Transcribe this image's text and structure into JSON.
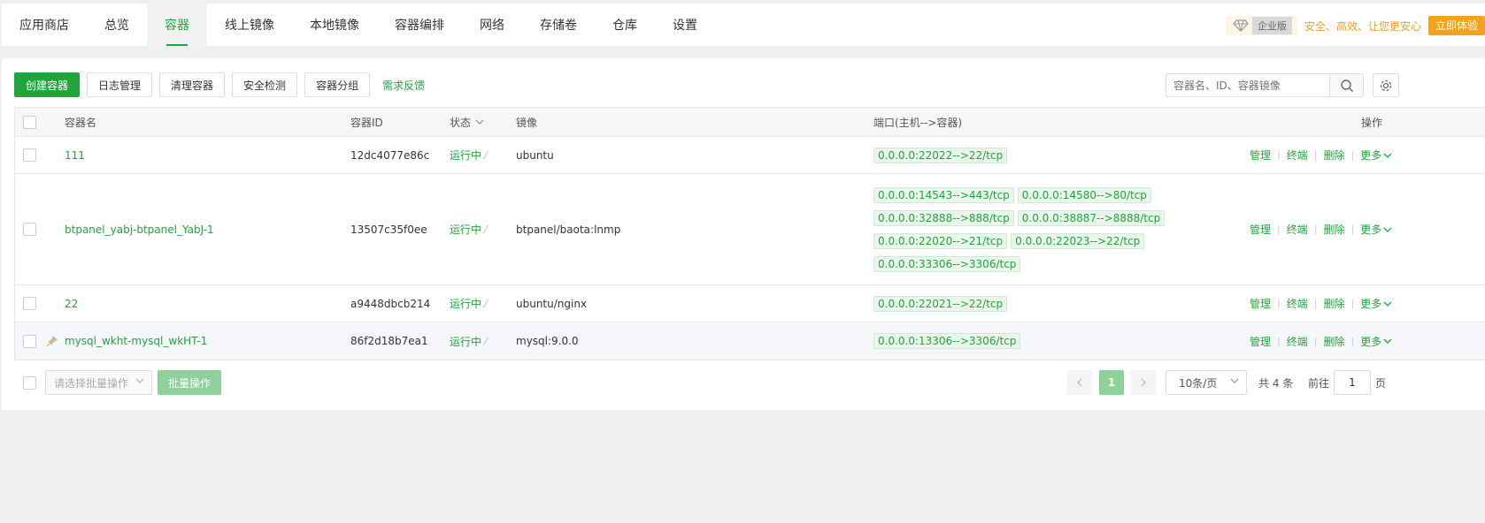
{
  "nav": {
    "items": [
      "应用商店",
      "总览",
      "容器",
      "线上镜像",
      "本地镜像",
      "容器编排",
      "网络",
      "存储卷",
      "仓库",
      "设置"
    ],
    "active_index": 2,
    "enterprise_tag": "企业版",
    "enterprise_slogan": "安全、高效、让您更安心",
    "enterprise_button": "立即体验"
  },
  "toolbar": {
    "create": "创建容器",
    "logs": "日志管理",
    "clean": "清理容器",
    "security": "安全检测",
    "group": "容器分组",
    "feedback": "需求反馈",
    "search_placeholder": "容器名、ID、容器镜像"
  },
  "table": {
    "headers": {
      "name": "容器名",
      "id": "容器ID",
      "status": "状态",
      "image": "镜像",
      "ports": "端口(主机-->容器)",
      "ops": "操作"
    },
    "rows": [
      {
        "name": "111",
        "id": "12dc4077e86c",
        "status": "运行中",
        "image": "ubuntu",
        "ports": [
          "0.0.0.0:22022-->22/tcp"
        ]
      },
      {
        "name": "btpanel_yabj-btpanel_YabJ-1",
        "id": "13507c35f0ee",
        "status": "运行中",
        "image": "btpanel/baota:lnmp",
        "ports": [
          "0.0.0.0:14543-->443/tcp",
          "0.0.0.0:14580-->80/tcp",
          "0.0.0.0:32888-->888/tcp",
          "0.0.0.0:38887-->8888/tcp",
          "0.0.0.0:22020-->21/tcp",
          "0.0.0.0:22023-->22/tcp",
          "0.0.0.0:33306-->3306/tcp"
        ]
      },
      {
        "name": "22",
        "id": "a9448dbcb214",
        "status": "运行中",
        "image": "ubuntu/nginx",
        "ports": [
          "0.0.0.0:22021-->22/tcp"
        ]
      },
      {
        "name": "mysql_wkht-mysql_wkHT-1",
        "id": "86f2d18b7ea1",
        "status": "运行中",
        "image": "mysql:9.0.0",
        "ports": [
          "0.0.0.0:13306-->3306/tcp"
        ],
        "pinned": true
      }
    ],
    "ops": {
      "manage": "管理",
      "terminal": "终端",
      "delete": "删除",
      "more": "更多"
    }
  },
  "footer": {
    "batch_select_placeholder": "请选择批量操作",
    "batch_button": "批量操作",
    "current_page": "1",
    "page_size": "10条/页",
    "total": "共 4 条",
    "goto_label": "前往",
    "goto_value": "1",
    "goto_suffix": "页"
  },
  "colors": {
    "accent": "#20a53a",
    "enterprise": "#f2a31b"
  }
}
